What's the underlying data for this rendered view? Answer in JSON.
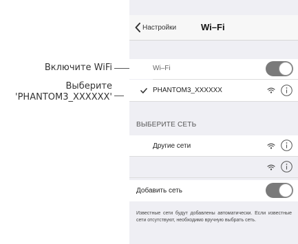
{
  "annotations": {
    "enable_wifi": "Включите WiFi",
    "select_line1": "Выберите",
    "select_line2": "'PHANTOM3_XXXXXX'"
  },
  "nav": {
    "back_label": "Настройки",
    "title": "Wi–Fi"
  },
  "wifi_row": {
    "label": "Wi–Fi",
    "enabled": true
  },
  "connected_network": {
    "name": "PHANTOM3_XXXXXX",
    "selected": true,
    "icons": [
      "checkmark-icon",
      "wifi-signal-icon",
      "info-icon"
    ]
  },
  "choose_network": {
    "header": "ВЫБЕРИТЕ СЕТЬ",
    "other_label": "Другие сети",
    "icons": [
      "wifi-signal-icon",
      "info-icon"
    ]
  },
  "add_network": {
    "label": "Добавить сеть",
    "enabled": true
  },
  "footer_note": "Известные сети будут добавлены автоматически. Если известные сети отсутствуют, необходимо вручную выбрать сеть.",
  "colors": {
    "toggle_on": "#7a7a7a",
    "grouped_background": "#efeff4",
    "cell_background": "#ffffff"
  }
}
